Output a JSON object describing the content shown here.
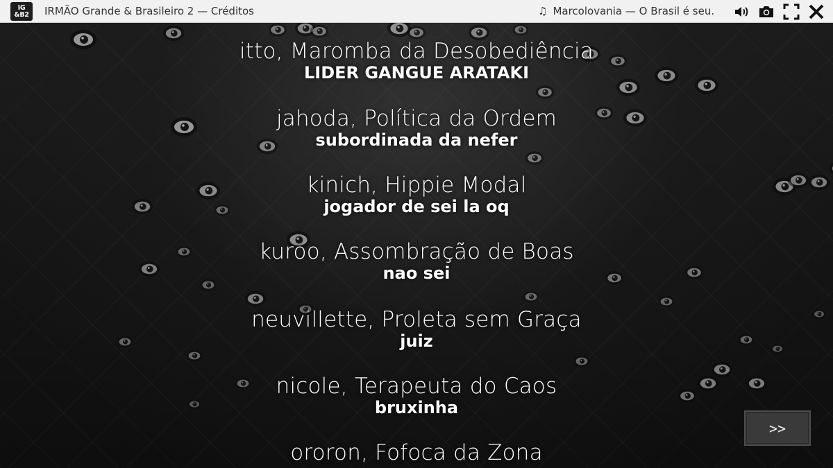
{
  "topbar": {
    "logo_line1": "IG",
    "logo_line2": "&B2",
    "title": "IRMÃO Grande & Brasileiro 2 — Créditos",
    "music_note": "♫",
    "now_playing": "Marcolovania — O Brasil é seu..."
  },
  "icons": [
    "speaker-icon",
    "camera-icon",
    "fullscreen-icon",
    "close-icon",
    "eye-icon"
  ],
  "credits": [
    {
      "name": "itto, Maromba da Desobediência",
      "role": "LIDER GANGUE ARATAKI"
    },
    {
      "name": "jahoda, Política da Ordem",
      "role": "subordinada da nefer"
    },
    {
      "name": "kinich, Hippie Modal",
      "role": "jogador de sei la oq"
    },
    {
      "name": "kuroo, Assombração de Boas",
      "role": "nao sei"
    },
    {
      "name": "neuvillette, Proleta sem Graça",
      "role": "juiz"
    },
    {
      "name": "nicole, Terapeuta do Caos",
      "role": "bruxinha"
    },
    {
      "name": "ororon, Fofoca da Zona",
      "role": ""
    }
  ],
  "skip_label": ">>",
  "colors": {
    "background": "#141414",
    "text": "#ffffff",
    "topbar": "#f1f1f1",
    "skip_button": "#3a3a3a"
  }
}
